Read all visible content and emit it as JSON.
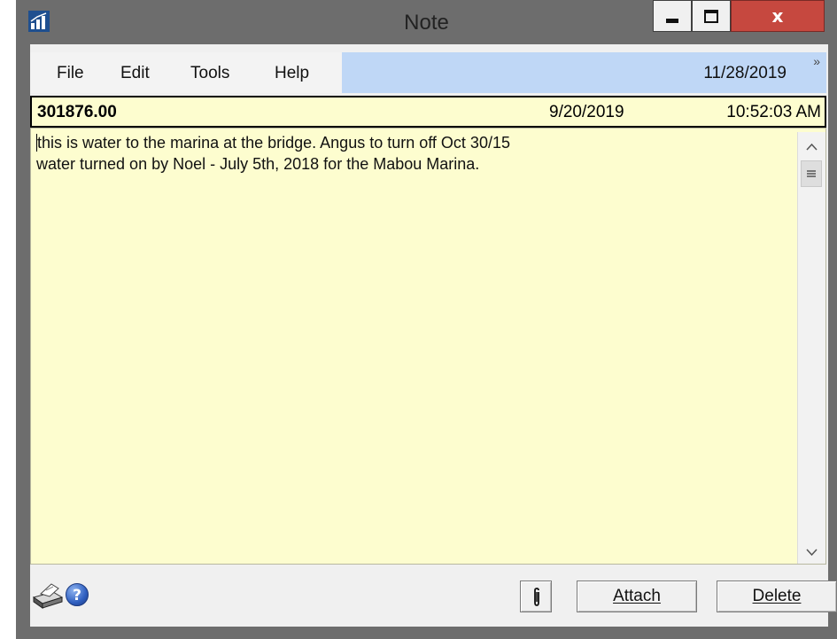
{
  "window": {
    "title": "Note",
    "icon": "app-chart-icon",
    "controls": {
      "minimize": "minimize-icon",
      "maximize": "maximize-icon",
      "close": "x"
    }
  },
  "menubar": {
    "items": [
      "File",
      "Edit",
      "Tools",
      "Help"
    ],
    "date": "11/28/2019",
    "expand_icon": "»"
  },
  "note": {
    "id": "301876.00",
    "date": "9/20/2019",
    "time": "10:52:03 AM",
    "text": "this is water to the marina at the bridge. Angus to turn off Oct 30/15\nwater turned on by Noel - July 5th, 2018 for the Mabou Marina."
  },
  "scrollbar": {
    "up": "^",
    "down": "v"
  },
  "footer": {
    "help_glyph": "?",
    "attach_label": "Attach",
    "delete_label": "Delete"
  },
  "colors": {
    "note_background": "#fdfdcf",
    "menu_highlight": "#bfd7f6",
    "close_button": "#c6483f",
    "window_frame": "#6d6d6d"
  }
}
